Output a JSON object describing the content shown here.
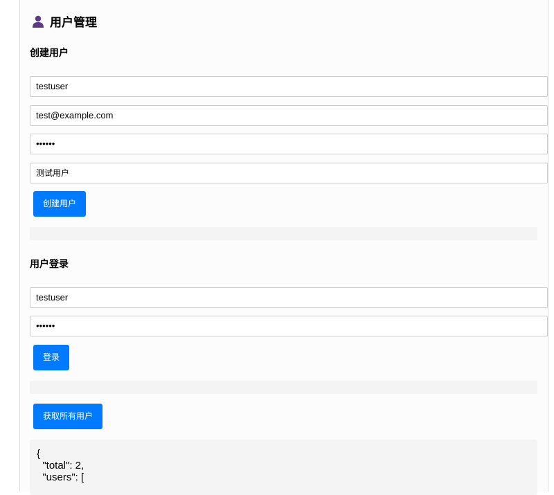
{
  "page": {
    "title": "用户管理",
    "icon": "user-icon"
  },
  "create_user": {
    "heading": "创建用户",
    "username_value": "testuser",
    "email_value": "test@example.com",
    "password_value": "••••••",
    "display_name_value": "测试用户",
    "submit_label": "创建用户"
  },
  "login": {
    "heading": "用户登录",
    "username_value": "testuser",
    "password_value": "••••••",
    "submit_label": "登录"
  },
  "users": {
    "fetch_label": "获取所有用户",
    "json_lines": [
      "{",
      "  \"total\": 2,",
      "  \"users\": ["
    ]
  },
  "colors": {
    "primary": "#007bff",
    "icon": "#5b3a8a"
  }
}
